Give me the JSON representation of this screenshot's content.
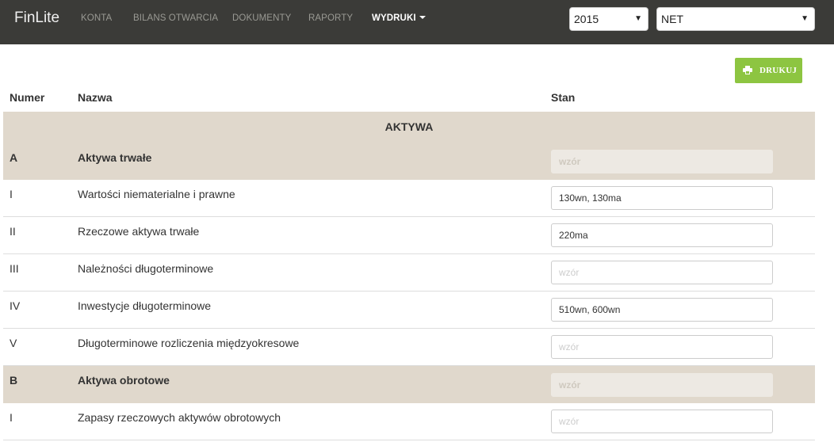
{
  "app": {
    "brand": "FinLite"
  },
  "nav": {
    "konta": "KONTA",
    "bilans": "BILANS OTWARCIA",
    "dokumenty": "DOKUMENTY",
    "raporty": "RAPORTY",
    "wydruki": "WYDRUKI"
  },
  "selects": {
    "year": "2015",
    "type": "NET"
  },
  "toolbar": {
    "print_label": "DRUKUJ"
  },
  "table": {
    "headers": {
      "numer": "Numer",
      "nazwa": "Nazwa",
      "stan": "Stan"
    },
    "section": "AKTYWA",
    "placeholder": "wzór",
    "rows": [
      {
        "num": "A",
        "name": "Aktywa trwałe",
        "value": ""
      },
      {
        "num": "I",
        "name": "Wartości niematerialne i prawne",
        "value": "130wn, 130ma"
      },
      {
        "num": "II",
        "name": "Rzeczowe aktywa trwałe",
        "value": "220ma"
      },
      {
        "num": "III",
        "name": "Należności długoterminowe",
        "value": ""
      },
      {
        "num": "IV",
        "name": "Inwestycje długoterminowe",
        "value": "510wn, 600wn"
      },
      {
        "num": "V",
        "name": "Długoterminowe rozliczenia międzyokresowe",
        "value": ""
      },
      {
        "num": "B",
        "name": "Aktywa obrotowe",
        "value": ""
      },
      {
        "num": "I",
        "name": "Zapasy rzeczowych aktywów obrotowych",
        "value": ""
      }
    ]
  }
}
